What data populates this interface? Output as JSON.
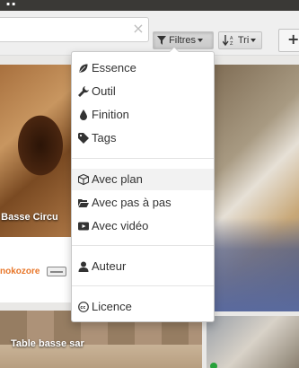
{
  "toolbar": {
    "search": {
      "value": "",
      "placeholder": ""
    },
    "filters_label": "Filtres",
    "sort_label": "Tri",
    "add_label": "+"
  },
  "filter_menu": {
    "items": [
      {
        "label": "Essence",
        "icon": "leaf-icon"
      },
      {
        "label": "Outil",
        "icon": "wrench-icon"
      },
      {
        "label": "Finition",
        "icon": "drop-icon"
      },
      {
        "label": "Tags",
        "icon": "tag-icon"
      },
      {
        "label": "Avec plan",
        "icon": "cube-icon",
        "highlighted": true
      },
      {
        "label": "Avec pas à pas",
        "icon": "folder-open-icon"
      },
      {
        "label": "Avec vidéo",
        "icon": "video-icon"
      },
      {
        "label": "Auteur",
        "icon": "user-icon"
      },
      {
        "label": "Licence",
        "icon": "creative-commons-icon"
      }
    ]
  },
  "cards": {
    "left": {
      "caption": "e Basse Circu",
      "author": "nokozore"
    },
    "right": {
      "caption": "Table basse sar"
    }
  },
  "colors": {
    "accent": "#e8772a",
    "topbar": "#3a3936",
    "status": "#27a13a"
  }
}
